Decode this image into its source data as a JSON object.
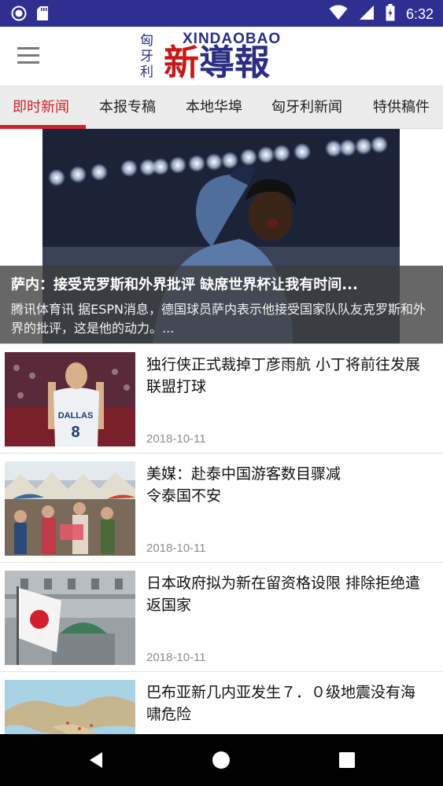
{
  "status_bar": {
    "time": "6:32",
    "left_icons": [
      "record-icon",
      "sd-card-icon"
    ],
    "right_icons": [
      "wifi-icon",
      "signal-icon",
      "battery-icon"
    ]
  },
  "header": {
    "logo_side_text": "匈牙利",
    "logo_latin": "XINDAOBAO",
    "logo_cn_part1": "新",
    "logo_cn_part2": "導報",
    "colors": {
      "brand_blue": "#2b2e83",
      "brand_red": "#c51a1a"
    }
  },
  "tabs": [
    {
      "label": "即时新闻",
      "active": true
    },
    {
      "label": "本报专稿",
      "active": false
    },
    {
      "label": "本地华埠",
      "active": false
    },
    {
      "label": "匈牙利新闻",
      "active": false
    },
    {
      "label": "特供稿件",
      "active": false
    }
  ],
  "accent_color": "#d2202a",
  "hero": {
    "title": "萨内：接受克罗斯和外界批评 缺席世界杯让我有时间...",
    "summary": "腾讯体育讯 据ESPN消息，德国球员萨内表示他接受国家队队友克罗斯和外界的批评，这是他的动力。..."
  },
  "news_items": [
    {
      "title": "独行侠正式裁掉丁彦雨航 小丁将前往发展联盟打球",
      "date": "2018-10-11"
    },
    {
      "title": "美媒：赴泰中国游客数目骤减\n令泰国不安",
      "date": "2018-10-11"
    },
    {
      "title": "日本政府拟为新在留资格设限 排除拒绝遣返国家",
      "date": "2018-10-11"
    },
    {
      "title": "巴布亚新几内亚发生７．０级地震没有海啸危险",
      "date": ""
    }
  ],
  "nav": {
    "icons": [
      "back-icon",
      "home-icon",
      "recents-icon"
    ]
  }
}
